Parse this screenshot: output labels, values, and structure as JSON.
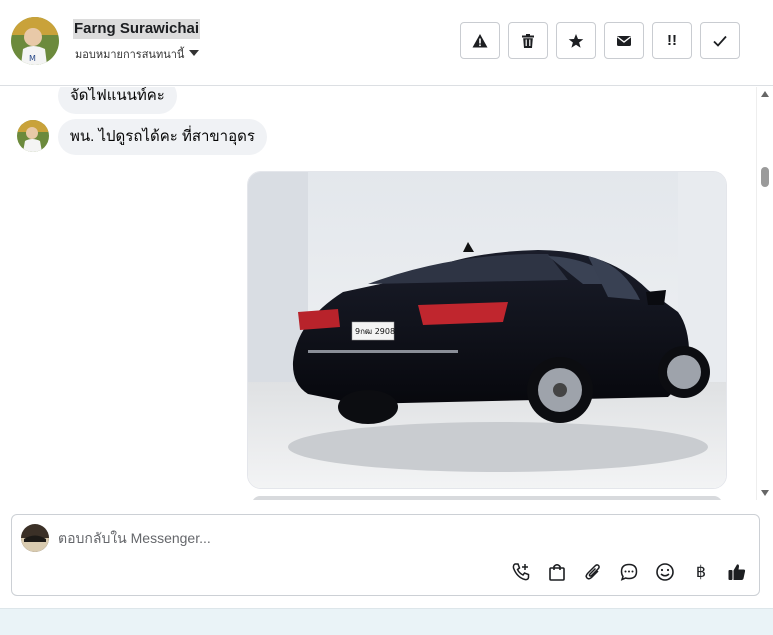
{
  "header": {
    "contact_name": "Farng Surawichai",
    "assign_label": "มอบหมายการสนทนานี้",
    "actions": [
      {
        "name": "report-spam-button",
        "icon": "warning-icon"
      },
      {
        "name": "delete-button",
        "icon": "trash-icon"
      },
      {
        "name": "star-button",
        "icon": "star-icon"
      },
      {
        "name": "mark-unread-button",
        "icon": "envelope-icon"
      },
      {
        "name": "mark-important-button",
        "icon": "double-exclamation-icon",
        "glyph": "!!"
      },
      {
        "name": "mark-done-button",
        "icon": "check-icon"
      }
    ]
  },
  "thread": {
    "messages": [
      {
        "text": "จัดไฟแนนท์คะ"
      },
      {
        "text": "พน. ไปดูรถได้คะ ที่สาขาอุดร"
      }
    ],
    "photo": {
      "plate": "9กฒ 2908"
    }
  },
  "composer": {
    "placeholder": "ตอบกลับใน Messenger...",
    "tools": [
      "phone-add-icon",
      "shopping-bag-icon",
      "paperclip-icon",
      "chat-bubble-icon",
      "smiley-icon",
      "baht-icon",
      "thumbs-up-icon"
    ],
    "baht_glyph": "฿"
  },
  "colors": {
    "accent": "#1c1e21",
    "bubble": "#f0f2f5",
    "border": "#ccd0d5"
  }
}
